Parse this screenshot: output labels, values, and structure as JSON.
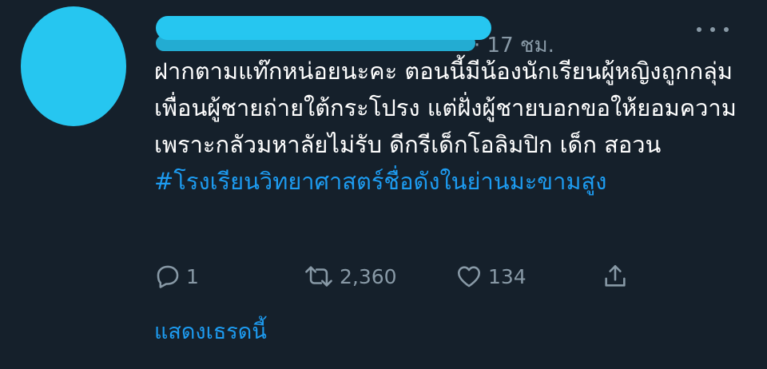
{
  "header": {
    "meta": "· 17 ชม."
  },
  "tweet": {
    "text": "ฝากตามแท๊กหน่อยนะคะ ตอนนี้มีน้องนักเรียนผู้หญิงถูกกลุ่มเพื่อนผู้ชายถ่ายใต้กระโปรง แต่ฝั่งผู้ชายบอกขอให้ยอมความเพราะกลัวมหาลัยไม่รับ ดีกรีเด็กโอลิมปิก เด็ก สอวน ",
    "hashtag": "#โรงเรียนวิทยาศาสตร์ชื่อดังในย่านมะขามสูง"
  },
  "actions": {
    "reply_count": "1",
    "retweet_count": "2,360",
    "like_count": "134"
  },
  "show_thread": "แสดงเธรดนี้",
  "colors": {
    "background": "#15202b",
    "accent": "#1d9bf0",
    "secondary_text": "#8899a6",
    "redaction": "#26c6f0"
  },
  "icons": [
    "more-icon",
    "reply-icon",
    "retweet-icon",
    "like-icon",
    "share-icon"
  ]
}
